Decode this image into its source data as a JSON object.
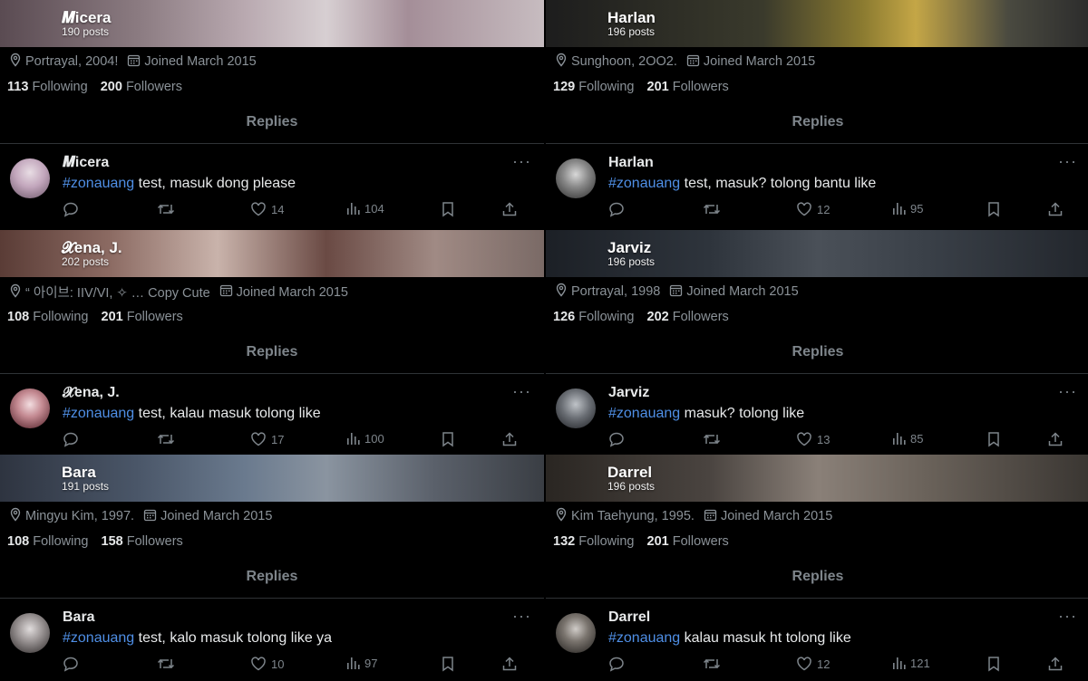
{
  "colors": {
    "background": "#000000",
    "hashtag": "#4f8fe6",
    "muted": "#7e858b",
    "text": "#e7e9ea"
  },
  "tab_label": "Replies",
  "profiles": [
    {
      "id": "p0",
      "name": "𝑴icera",
      "posts": "190 posts",
      "location": "Portrayal, 2004!",
      "joined": "Joined March 2015",
      "following_count": "113",
      "following_label": "Following",
      "followers_count": "200",
      "followers_label": "Followers",
      "tweet": {
        "name": "𝑴icera",
        "hashtag": "#zonauang",
        "text": " test, masuk dong please",
        "likes": "14",
        "views": "104"
      },
      "banner_gradient": "linear-gradient(90deg,#5a4b52 0%,#8a7a80 25%,#b9a9b0 45%,#d7cfd2 60%,#a48e98 75%,#c7bcc0 100%)",
      "avatar_gradient": "radial-gradient(circle at 50% 35%,#e8dde4 0%,#c2a6bc 45%,#6b5668 100%)"
    },
    {
      "id": "p1",
      "name": "Harlan",
      "posts": "196 posts",
      "location": "Sunghoon, 2OO2.",
      "joined": "Joined March 2015",
      "following_count": "129",
      "following_label": "Following",
      "followers_count": "201",
      "followers_label": "Followers",
      "tweet": {
        "name": "Harlan",
        "hashtag": "#zonauang",
        "text": " test, masuk? tolong bantu like",
        "likes": "12",
        "views": "95"
      },
      "banner_gradient": "linear-gradient(90deg,#1d1d1d 0%,#3a3a2c 40%,#8a7a30 58%,#c4a646 68%,#4a4a40 85%,#2c2c2c 100%)",
      "avatar_gradient": "radial-gradient(circle at 50% 40%,#d8d8d8 0%,#8a8a8a 40%,#2a2a2a 100%)"
    },
    {
      "id": "p2",
      "name": "𝓧ena, J.",
      "posts": "202 posts",
      "location": "“ 아이브:  IIV/VI,   ✧  … Copy Cute",
      "joined": "Joined March 2015",
      "following_count": "108",
      "following_label": "Following",
      "followers_count": "201",
      "followers_label": "Followers",
      "tweet": {
        "name": "𝓧ena, J.",
        "hashtag": "#zonauang",
        "text": " test, kalau masuk tolong like",
        "likes": "17",
        "views": "100"
      },
      "banner_gradient": "linear-gradient(90deg,#5a3c36 0%,#8b6a62 20%,#c9b3ab 40%,#6a4a44 60%,#a08a84 80%,#7a6a66 100%)",
      "avatar_gradient": "radial-gradient(circle at 50% 40%,#f2dde0 0%,#c48a92 40%,#4a1a22 100%)"
    },
    {
      "id": "p3",
      "name": "Jarviz",
      "posts": "196 posts",
      "location": "Portrayal, 1998",
      "joined": "Joined March 2015",
      "following_count": "126",
      "following_label": "Following",
      "followers_count": "202",
      "followers_label": "Followers",
      "tweet": {
        "name": "Jarviz",
        "hashtag": "#zonauang",
        "text": " masuk? tolong like",
        "likes": "13",
        "views": "85"
      },
      "banner_gradient": "linear-gradient(90deg,#1c2026 0%,#2e343c 30%,#4a5058 50%,#3a4048 70%,#22262c 100%)",
      "avatar_gradient": "radial-gradient(circle at 50% 40%,#bfc3c8 0%,#6a6e74 45%,#1c1e22 100%)"
    },
    {
      "id": "p4",
      "name": "Bara",
      "posts": "191 posts",
      "location": "Mingyu Kim, 1997.",
      "joined": "Joined March 2015",
      "following_count": "108",
      "following_label": "Following",
      "followers_count": "158",
      "followers_label": "Followers",
      "tweet": {
        "name": "Bara",
        "hashtag": "#zonauang",
        "text": " test, kalo masuk tolong like ya",
        "likes": "10",
        "views": "97"
      },
      "banner_gradient": "linear-gradient(90deg,#2e3440 0%,#4a5668 25%,#6a7a8e 45%,#8a94a0 60%,#5a606a 80%,#3a3e44 100%)",
      "avatar_gradient": "radial-gradient(circle at 50% 40%,#e0dcdc 0%,#9a9494 40%,#2a2626 100%)"
    },
    {
      "id": "p5",
      "name": "Darrel",
      "posts": "196 posts",
      "location": "Kim Taehyung, 1995.",
      "joined": "Joined March 2015",
      "following_count": "132",
      "following_label": "Following",
      "followers_count": "201",
      "followers_label": "Followers",
      "tweet": {
        "name": "Darrel",
        "hashtag": "#zonauang",
        "text": " kalau masuk ht tolong like",
        "likes": "12",
        "views": "121"
      },
      "banner_gradient": "linear-gradient(90deg,#2a2622 0%,#4a4440 30%,#8a8078 50%,#6a625a 70%,#3a3632 100%)",
      "avatar_gradient": "radial-gradient(circle at 50% 40%,#d0ccc8 0%,#7a746e 40%,#1e1c1a 100%)"
    }
  ]
}
